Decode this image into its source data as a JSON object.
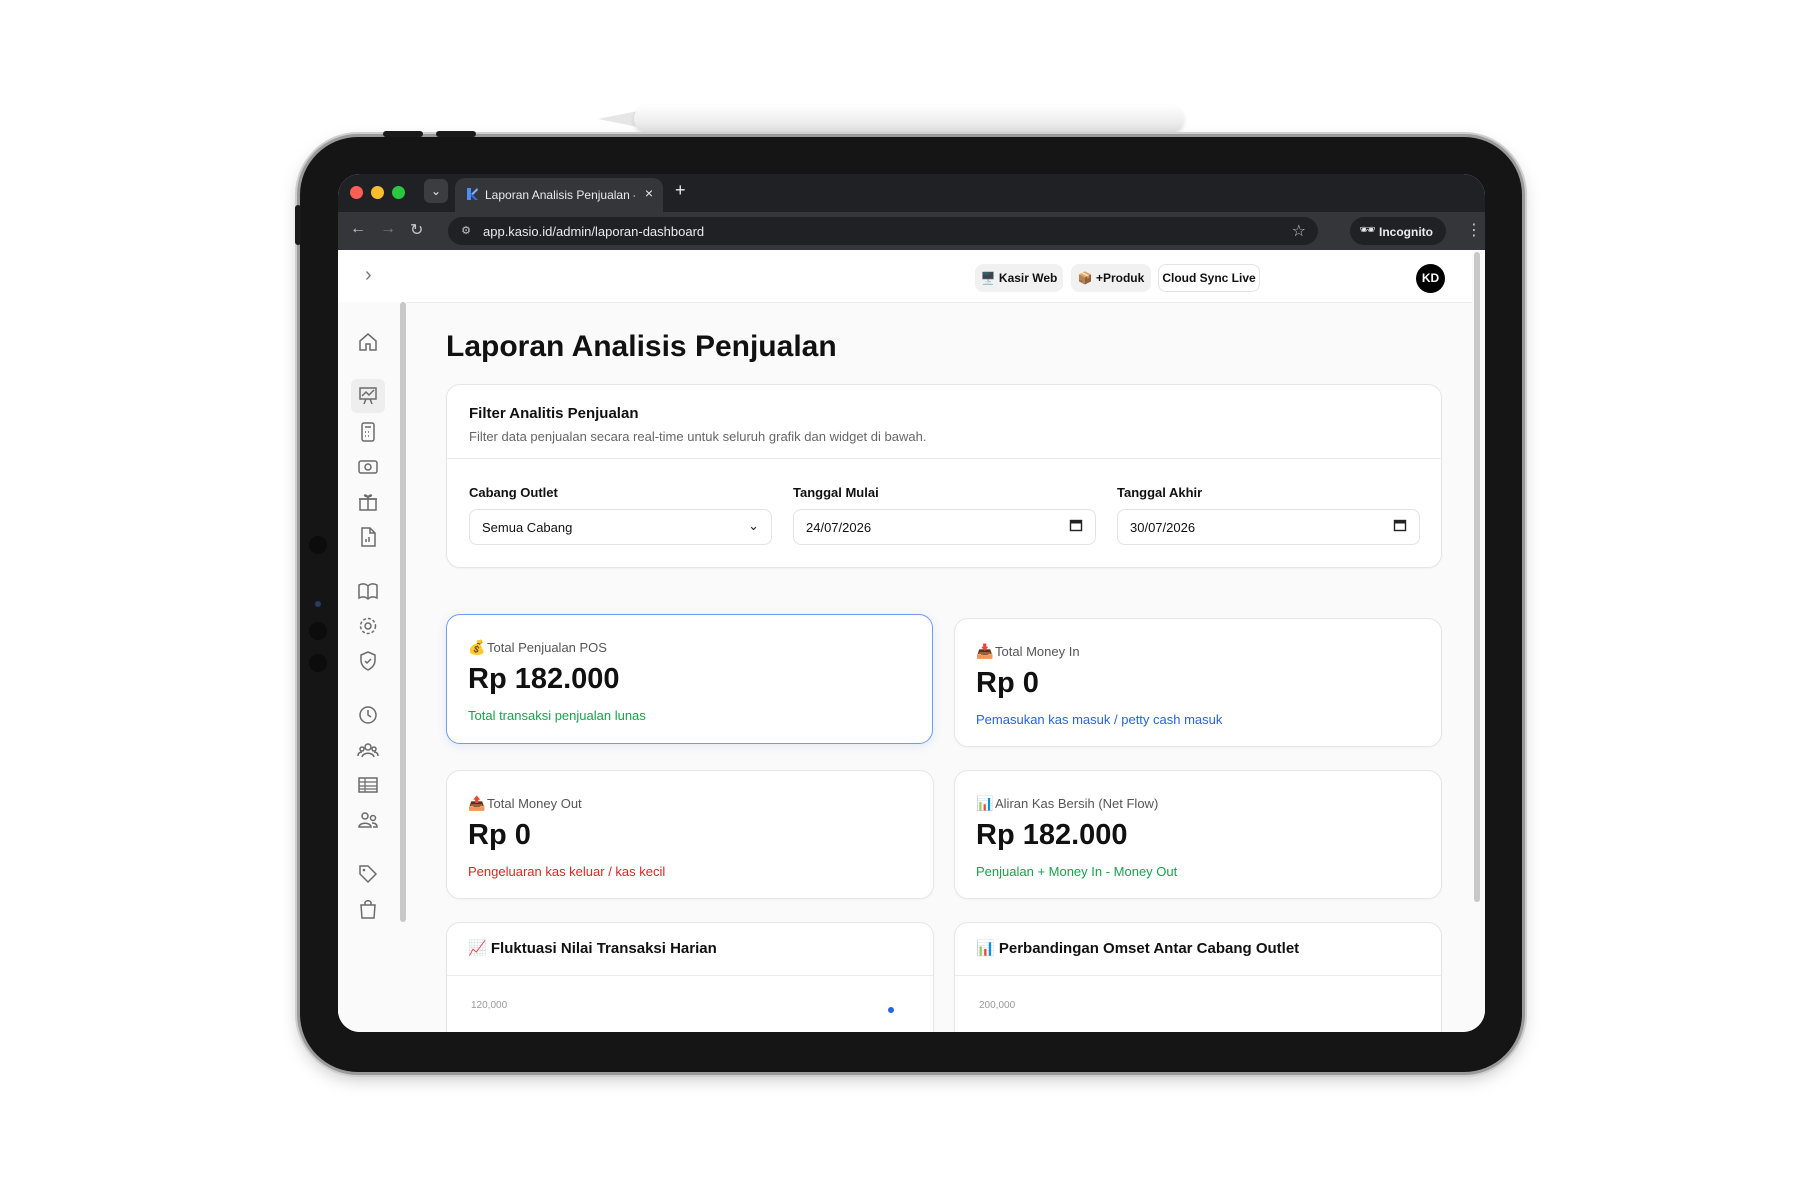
{
  "browser": {
    "tab_title": "Laporan Analisis Penjualan - Kasio",
    "url": "app.kasio.id/admin/laporan-dashboard",
    "incognito_label": "Incognito",
    "new_tab_symbol": "+",
    "close_symbol": "×"
  },
  "header": {
    "buttons": [
      {
        "icon": "🖥️",
        "label": "Kasir Web"
      },
      {
        "icon": "📦",
        "label": "+Produk"
      },
      {
        "label": "Cloud Sync Live"
      }
    ],
    "avatar_initials": "KD"
  },
  "page": {
    "title": "Laporan Analisis Penjualan"
  },
  "filter": {
    "title": "Filter Analitis Penjualan",
    "subtitle": "Filter data penjualan secara real-time untuk seluruh grafik dan widget di bawah.",
    "fields": [
      {
        "label": "Cabang Outlet",
        "value": "Semua Cabang",
        "type": "select"
      },
      {
        "label": "Tanggal Mulai",
        "value": "24/07/2026",
        "type": "date"
      },
      {
        "label": "Tanggal Akhir",
        "value": "30/07/2026",
        "type": "date"
      }
    ]
  },
  "stats": [
    {
      "icon": "💰",
      "label": "Total Penjualan POS",
      "value": "Rp 182.000",
      "note": "Total transaksi penjualan lunas",
      "note_color": "#16a34a"
    },
    {
      "icon": "📥",
      "label": "Total Money In",
      "value": "Rp 0",
      "note": "Pemasukan kas masuk / petty cash masuk",
      "note_color": "#2563eb"
    },
    {
      "icon": "📤",
      "label": "Total Money Out",
      "value": "Rp 0",
      "note": "Pengeluaran kas keluar / kas kecil",
      "note_color": "#dc2626"
    },
    {
      "icon": "📊",
      "label": "Aliran Kas Bersih (Net Flow)",
      "value": "Rp 182.000",
      "note": "Penjualan + Money In - Money Out",
      "note_color": "#16a34a"
    }
  ],
  "charts": [
    {
      "icon": "📈",
      "title": "Fluktuasi Nilai Transaksi Harian",
      "top_tick": "120,000"
    },
    {
      "icon": "📊",
      "title": "Perbandingan Omset Antar Cabang Outlet",
      "top_tick": "200,000"
    }
  ],
  "colors": {
    "accent": "#2563eb",
    "positive": "#16a34a",
    "negative": "#dc2626"
  }
}
